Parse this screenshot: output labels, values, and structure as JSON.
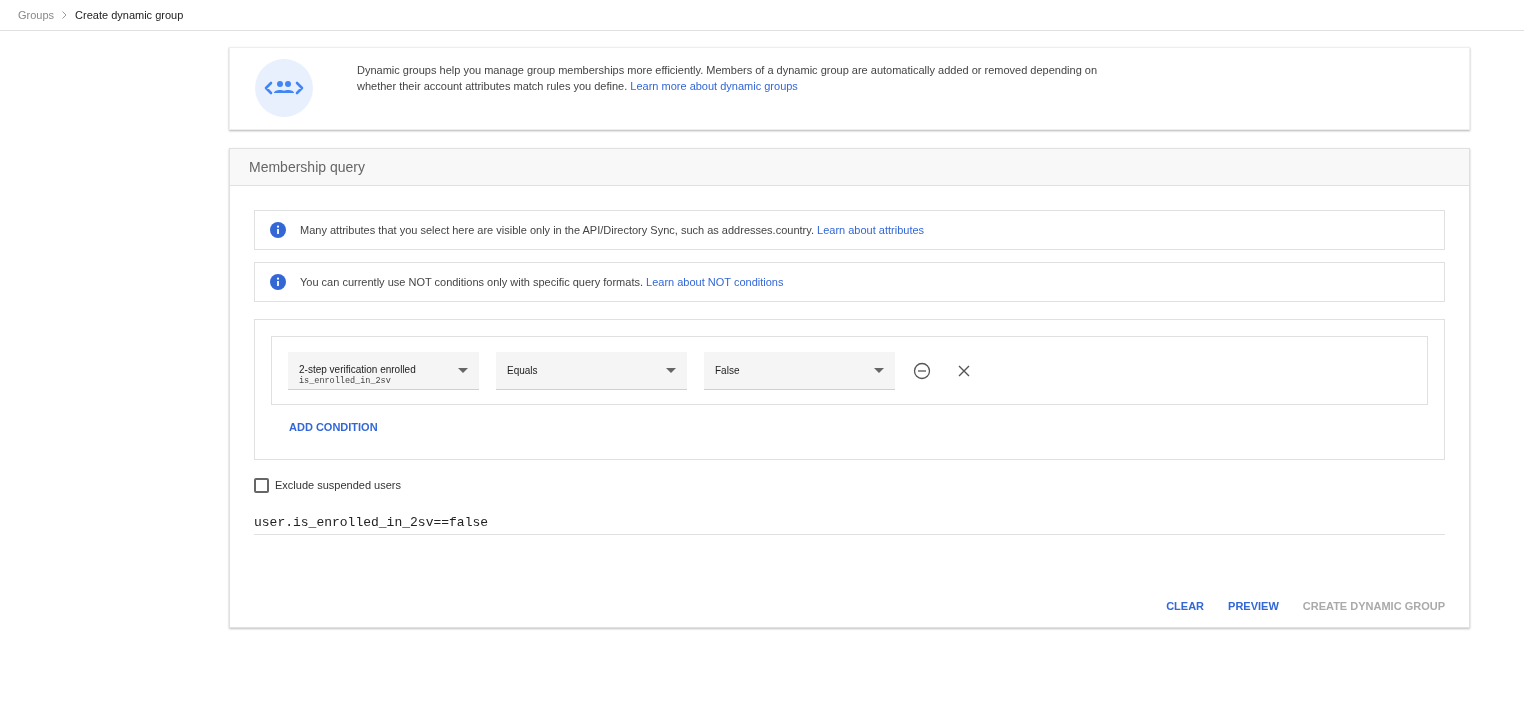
{
  "breadcrumb": [
    {
      "label": "Groups",
      "current": false
    },
    {
      "label": "Create dynamic group",
      "current": true
    }
  ],
  "intro": {
    "text": "Dynamic groups help you manage group memberships more efficiently. Members of a dynamic group are automatically added or removed depending on whether their account attributes match rules you define.",
    "link": "Learn more about dynamic groups"
  },
  "membership_query": {
    "title": "Membership query",
    "notices": [
      {
        "text": "Many attributes that you select here are visible only in the API/Directory Sync, such as addresses.country.",
        "link": "Learn about attributes"
      },
      {
        "text": "You can currently use NOT conditions only with specific query formats.",
        "link": "Learn about NOT conditions"
      }
    ],
    "condition": {
      "attribute": "2-step verification enrolled",
      "attribute_key": "is_enrolled_in_2sv",
      "operator": "Equals",
      "value": "False"
    },
    "add_condition": "ADD CONDITION",
    "exclude_suspended": {
      "label": "Exclude suspended users",
      "checked": false
    },
    "query": "user.is_enrolled_in_2sv==false",
    "buttons": [
      {
        "label": "CLEAR",
        "disabled": false
      },
      {
        "label": "PREVIEW",
        "disabled": false
      },
      {
        "label": "CREATE DYNAMIC GROUP",
        "disabled": true
      }
    ]
  }
}
